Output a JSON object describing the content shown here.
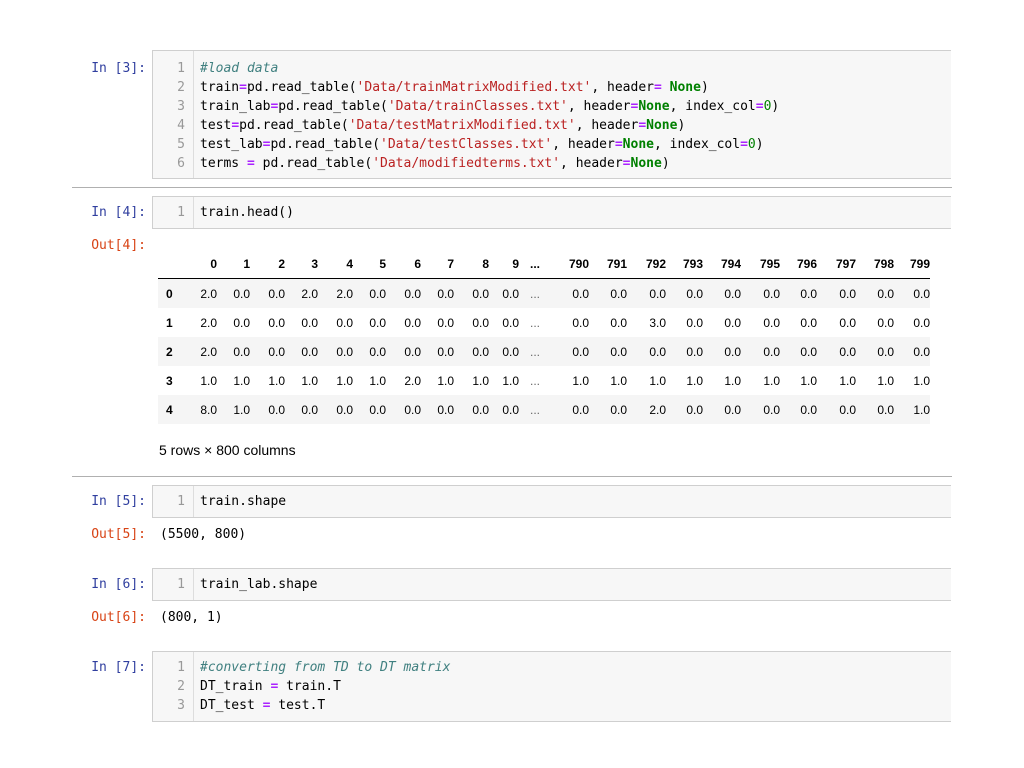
{
  "cells": {
    "c3": {
      "prompt": "In [3]:",
      "lines": [
        {
          "n": "1",
          "parts": [
            {
              "t": "#load data",
              "c": "comment"
            }
          ]
        },
        {
          "n": "2",
          "parts": [
            {
              "t": "train",
              "c": ""
            },
            {
              "t": "=",
              "c": "op"
            },
            {
              "t": "pd.read_table(",
              "c": ""
            },
            {
              "t": "'Data/trainMatrixModified.txt'",
              "c": "str"
            },
            {
              "t": ", header",
              "c": ""
            },
            {
              "t": "=",
              "c": "op"
            },
            {
              "t": " ",
              "c": ""
            },
            {
              "t": "None",
              "c": "kw"
            },
            {
              "t": ")",
              "c": ""
            }
          ]
        },
        {
          "n": "3",
          "parts": [
            {
              "t": "train_lab",
              "c": ""
            },
            {
              "t": "=",
              "c": "op"
            },
            {
              "t": "pd.read_table(",
              "c": ""
            },
            {
              "t": "'Data/trainClasses.txt'",
              "c": "str"
            },
            {
              "t": ", header",
              "c": ""
            },
            {
              "t": "=",
              "c": "op"
            },
            {
              "t": "None",
              "c": "kw"
            },
            {
              "t": ", index_col",
              "c": ""
            },
            {
              "t": "=",
              "c": "op"
            },
            {
              "t": "0",
              "c": "num"
            },
            {
              "t": ")",
              "c": ""
            }
          ]
        },
        {
          "n": "4",
          "parts": [
            {
              "t": "test",
              "c": ""
            },
            {
              "t": "=",
              "c": "op"
            },
            {
              "t": "pd.read_table(",
              "c": ""
            },
            {
              "t": "'Data/testMatrixModified.txt'",
              "c": "str"
            },
            {
              "t": ", header",
              "c": ""
            },
            {
              "t": "=",
              "c": "op"
            },
            {
              "t": "None",
              "c": "kw"
            },
            {
              "t": ")",
              "c": ""
            }
          ]
        },
        {
          "n": "5",
          "parts": [
            {
              "t": "test_lab",
              "c": ""
            },
            {
              "t": "=",
              "c": "op"
            },
            {
              "t": "pd.read_table(",
              "c": ""
            },
            {
              "t": "'Data/testClasses.txt'",
              "c": "str"
            },
            {
              "t": ", header",
              "c": ""
            },
            {
              "t": "=",
              "c": "op"
            },
            {
              "t": "None",
              "c": "kw"
            },
            {
              "t": ", index_col",
              "c": ""
            },
            {
              "t": "=",
              "c": "op"
            },
            {
              "t": "0",
              "c": "num"
            },
            {
              "t": ")",
              "c": ""
            }
          ]
        },
        {
          "n": "6",
          "parts": [
            {
              "t": "terms ",
              "c": ""
            },
            {
              "t": "=",
              "c": "op"
            },
            {
              "t": " pd.read_table(",
              "c": ""
            },
            {
              "t": "'Data/modifiedterms.txt'",
              "c": "str"
            },
            {
              "t": ", header",
              "c": ""
            },
            {
              "t": "=",
              "c": "op"
            },
            {
              "t": "None",
              "c": "kw"
            },
            {
              "t": ")",
              "c": ""
            }
          ]
        }
      ]
    },
    "c4": {
      "prompt": "In [4]:",
      "out_prompt": "Out[4]:",
      "lines": [
        {
          "n": "1",
          "parts": [
            {
              "t": "train.head()",
              "c": ""
            }
          ]
        }
      ],
      "dataframe": {
        "columns": [
          "0",
          "1",
          "2",
          "3",
          "4",
          "5",
          "6",
          "7",
          "8",
          "9",
          "...",
          "790",
          "791",
          "792",
          "793",
          "794",
          "795",
          "796",
          "797",
          "798",
          "799"
        ],
        "rows": [
          {
            "index": "0",
            "values": [
              "2.0",
              "0.0",
              "0.0",
              "2.0",
              "2.0",
              "0.0",
              "0.0",
              "0.0",
              "0.0",
              "0.0",
              "...",
              "0.0",
              "0.0",
              "0.0",
              "0.0",
              "0.0",
              "0.0",
              "0.0",
              "0.0",
              "0.0",
              "0.0"
            ]
          },
          {
            "index": "1",
            "values": [
              "2.0",
              "0.0",
              "0.0",
              "0.0",
              "0.0",
              "0.0",
              "0.0",
              "0.0",
              "0.0",
              "0.0",
              "...",
              "0.0",
              "0.0",
              "3.0",
              "0.0",
              "0.0",
              "0.0",
              "0.0",
              "0.0",
              "0.0",
              "0.0"
            ]
          },
          {
            "index": "2",
            "values": [
              "2.0",
              "0.0",
              "0.0",
              "0.0",
              "0.0",
              "0.0",
              "0.0",
              "0.0",
              "0.0",
              "0.0",
              "...",
              "0.0",
              "0.0",
              "0.0",
              "0.0",
              "0.0",
              "0.0",
              "0.0",
              "0.0",
              "0.0",
              "0.0"
            ]
          },
          {
            "index": "3",
            "values": [
              "1.0",
              "1.0",
              "1.0",
              "1.0",
              "1.0",
              "1.0",
              "2.0",
              "1.0",
              "1.0",
              "1.0",
              "...",
              "1.0",
              "1.0",
              "1.0",
              "1.0",
              "1.0",
              "1.0",
              "1.0",
              "1.0",
              "1.0",
              "1.0"
            ]
          },
          {
            "index": "4",
            "values": [
              "8.0",
              "1.0",
              "0.0",
              "0.0",
              "0.0",
              "0.0",
              "0.0",
              "0.0",
              "0.0",
              "0.0",
              "...",
              "0.0",
              "0.0",
              "2.0",
              "0.0",
              "0.0",
              "0.0",
              "0.0",
              "0.0",
              "0.0",
              "1.0"
            ]
          }
        ],
        "shape_note": "5 rows × 800 columns"
      }
    },
    "c5": {
      "prompt": "In [5]:",
      "out_prompt": "Out[5]:",
      "lines": [
        {
          "n": "1",
          "parts": [
            {
              "t": "train.shape",
              "c": ""
            }
          ]
        }
      ],
      "output": "(5500, 800)"
    },
    "c6": {
      "prompt": "In [6]:",
      "out_prompt": "Out[6]:",
      "lines": [
        {
          "n": "1",
          "parts": [
            {
              "t": "train_lab.shape",
              "c": ""
            }
          ]
        }
      ],
      "output": "(800, 1)"
    },
    "c7": {
      "prompt": "In [7]:",
      "lines": [
        {
          "n": "1",
          "parts": [
            {
              "t": "#converting from TD to DT matrix",
              "c": "comment"
            }
          ]
        },
        {
          "n": "2",
          "parts": [
            {
              "t": "DT_train ",
              "c": ""
            },
            {
              "t": "=",
              "c": "op"
            },
            {
              "t": " train.T",
              "c": ""
            }
          ]
        },
        {
          "n": "3",
          "parts": [
            {
              "t": "DT_test ",
              "c": ""
            },
            {
              "t": "=",
              "c": "op"
            },
            {
              "t": " test.T",
              "c": ""
            }
          ]
        }
      ]
    }
  }
}
